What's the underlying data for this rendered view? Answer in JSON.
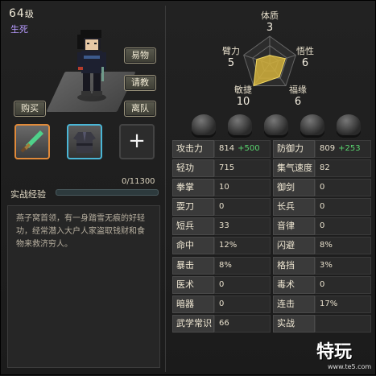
{
  "header": {
    "level": "64",
    "level_unit": "级",
    "status": "生死"
  },
  "buttons": {
    "trade": "易物",
    "ask": "请教",
    "leave": "离队",
    "buy": "购买"
  },
  "equipment": {
    "weapon_icon": "jade-dagger-icon",
    "armor_icon": "robe-icon",
    "empty_icon": "plus-icon",
    "empty_symbol": "+"
  },
  "experience": {
    "label": "实战经验",
    "value": "0/11300",
    "progress": 0.0
  },
  "description": "燕子窝首领，有一身踏雪无痕的好轻功，经常潜入大户人家盗取钱财和食物来救济穷人。",
  "radar": {
    "attributes": [
      {
        "name": "体质",
        "value": "3"
      },
      {
        "name": "悟性",
        "value": "6"
      },
      {
        "name": "福缘",
        "value": "6"
      },
      {
        "name": "敏捷",
        "value": "10"
      },
      {
        "name": "臂力",
        "value": "5"
      }
    ],
    "max": 10
  },
  "stats": [
    [
      {
        "label": "攻击力",
        "value": "814",
        "bonus": "+500"
      },
      {
        "label": "防御力",
        "value": "809",
        "bonus": "+253"
      }
    ],
    [
      {
        "label": "轻功",
        "value": "715"
      },
      {
        "label": "集气速度",
        "value": "82"
      }
    ],
    [
      {
        "label": "拳掌",
        "value": "10"
      },
      {
        "label": "御剑",
        "value": "0"
      }
    ],
    [
      {
        "label": "耍刀",
        "value": "0"
      },
      {
        "label": "长兵",
        "value": "0"
      }
    ],
    [
      {
        "label": "短兵",
        "value": "33"
      },
      {
        "label": "音律",
        "value": "0"
      }
    ],
    [
      {
        "label": "命中",
        "value": "12%"
      },
      {
        "label": "闪避",
        "value": "8%"
      }
    ],
    [
      {
        "label": "暴击",
        "value": "8%"
      },
      {
        "label": "格挡",
        "value": "3%"
      }
    ],
    [
      {
        "label": "医术",
        "value": "0"
      },
      {
        "label": "毒术",
        "value": "0"
      }
    ],
    [
      {
        "label": "暗器",
        "value": "0"
      },
      {
        "label": "连击",
        "value": "17%"
      }
    ],
    [
      {
        "label": "武学常识",
        "value": "66"
      },
      {
        "label": "实战",
        "value": ""
      }
    ]
  ],
  "watermark": {
    "text": "特玩",
    "url": "www.te5.com"
  },
  "colors": {
    "accent_orange": "#e08a3a",
    "accent_cyan": "#4ab6d6",
    "bonus_green": "#59d36e",
    "radar_fill": "#d4b23c"
  }
}
